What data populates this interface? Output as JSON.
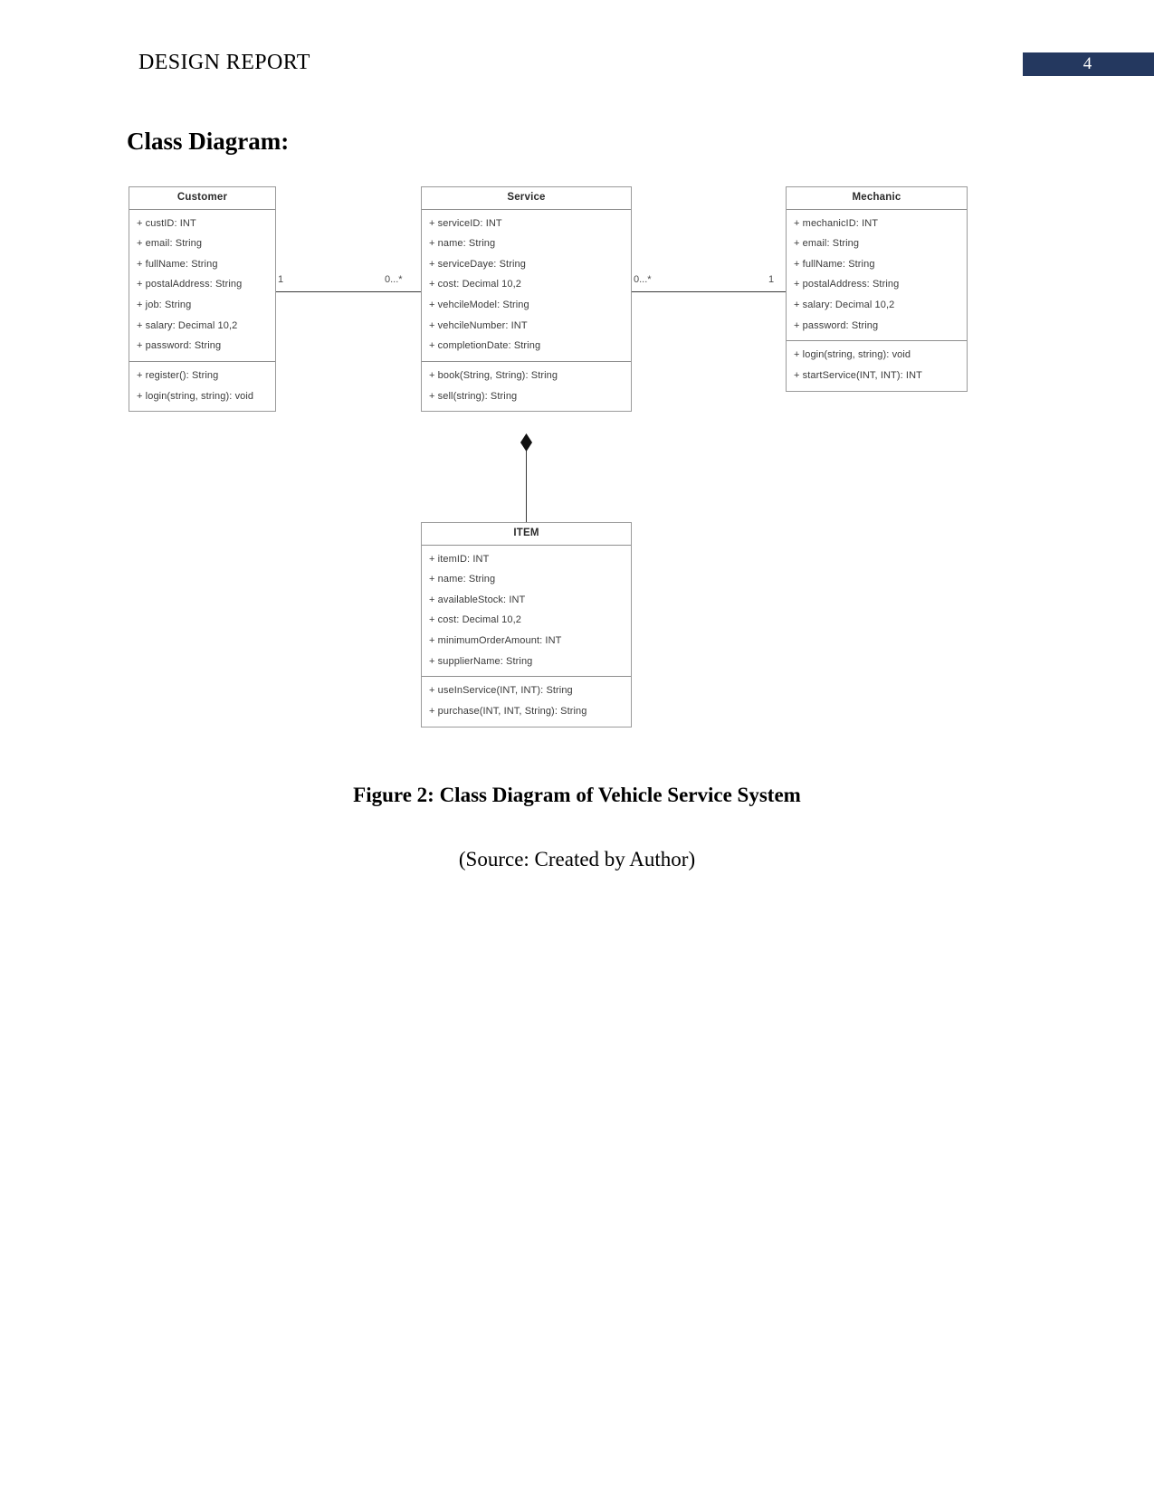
{
  "header": {
    "title": "DESIGN REPORT",
    "page_number": "4",
    "badge_color": "#24385F"
  },
  "section": {
    "heading": "Class Diagram:"
  },
  "diagram": {
    "classes": [
      {
        "name": "Customer",
        "attributes": [
          "+ custID: INT",
          "+ email: String",
          "+ fullName: String",
          "+ postalAddress: String",
          "+ job: String",
          "+ salary: Decimal 10,2",
          "+ password: String"
        ],
        "methods": [
          "+ register(): String",
          "+ login(string, string): void"
        ]
      },
      {
        "name": "Service",
        "attributes": [
          "+ serviceID: INT",
          "+ name: String",
          "+ serviceDaye: String",
          "+ cost: Decimal 10,2",
          "+ vehcileModel: String",
          "+ vehcileNumber: INT",
          "+ completionDate: String"
        ],
        "methods": [
          "+ book(String, String): String",
          "+ sell(string): String"
        ]
      },
      {
        "name": "Mechanic",
        "attributes": [
          "+ mechanicID: INT",
          "+ email: String",
          "+ fullName: String",
          "+ postalAddress: String",
          "+ salary: Decimal 10,2",
          "+ password: String"
        ],
        "methods": [
          "+ login(string, string): void",
          "+ startService(INT, INT): INT"
        ]
      },
      {
        "name": "ITEM",
        "attributes": [
          "+ itemID: INT",
          "+ name: String",
          "+ availableStock: INT",
          "+ cost: Decimal 10,2",
          "+ minimumOrderAmount: INT",
          "+ supplierName: String"
        ],
        "methods": [
          "+ useInService(INT, INT): String",
          "+ purchase(INT, INT, String): String"
        ]
      }
    ],
    "multiplicities": {
      "customer_side": "1",
      "service_left_side": "0...*",
      "service_right_side": "0...*",
      "mechanic_side": "1"
    }
  },
  "figure": {
    "caption": "Figure 2: Class Diagram of Vehicle Service System",
    "source": "(Source: Created by Author)"
  }
}
